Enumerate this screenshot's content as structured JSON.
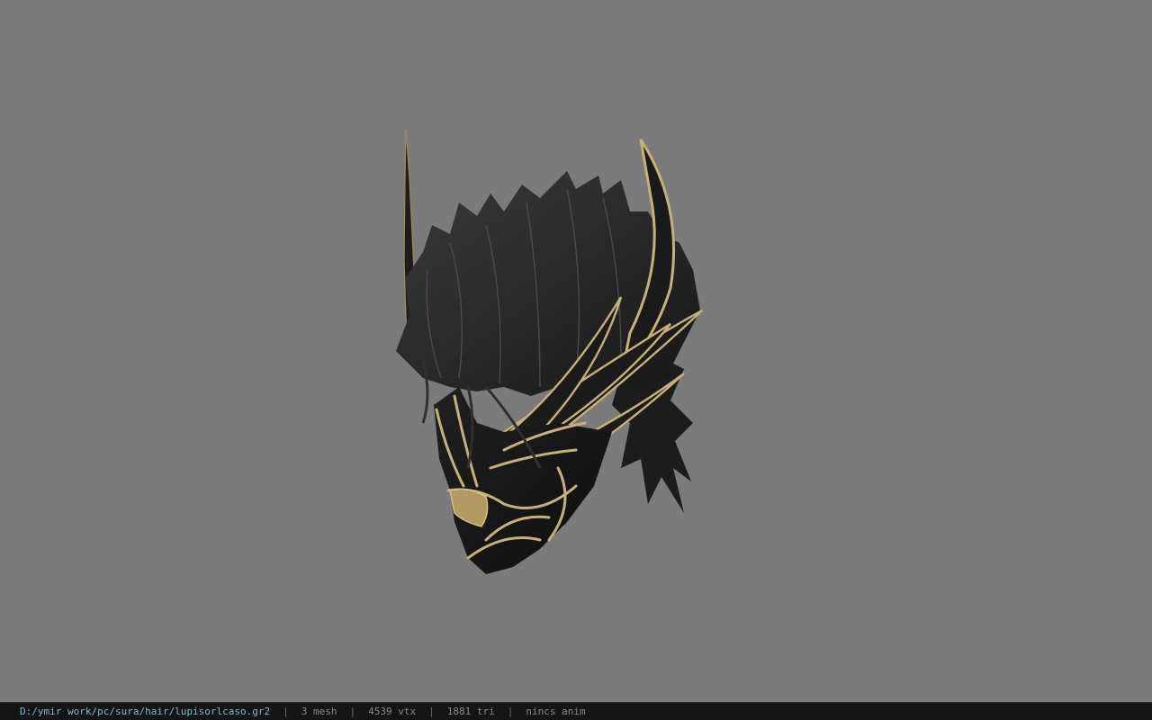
{
  "status": {
    "path": "D:/ymir work/pc/sura/hair/lupisorlcaso.gr2",
    "separator": "|",
    "mesh": "3 mesh",
    "vtx": "4539 vtx",
    "tri": "1881 tri",
    "anim": "nincs anim"
  },
  "colors": {
    "background": "#7b7b7b",
    "statusbar": "#151515",
    "path": "#7fb8d4",
    "gold": "#c9b07a"
  }
}
